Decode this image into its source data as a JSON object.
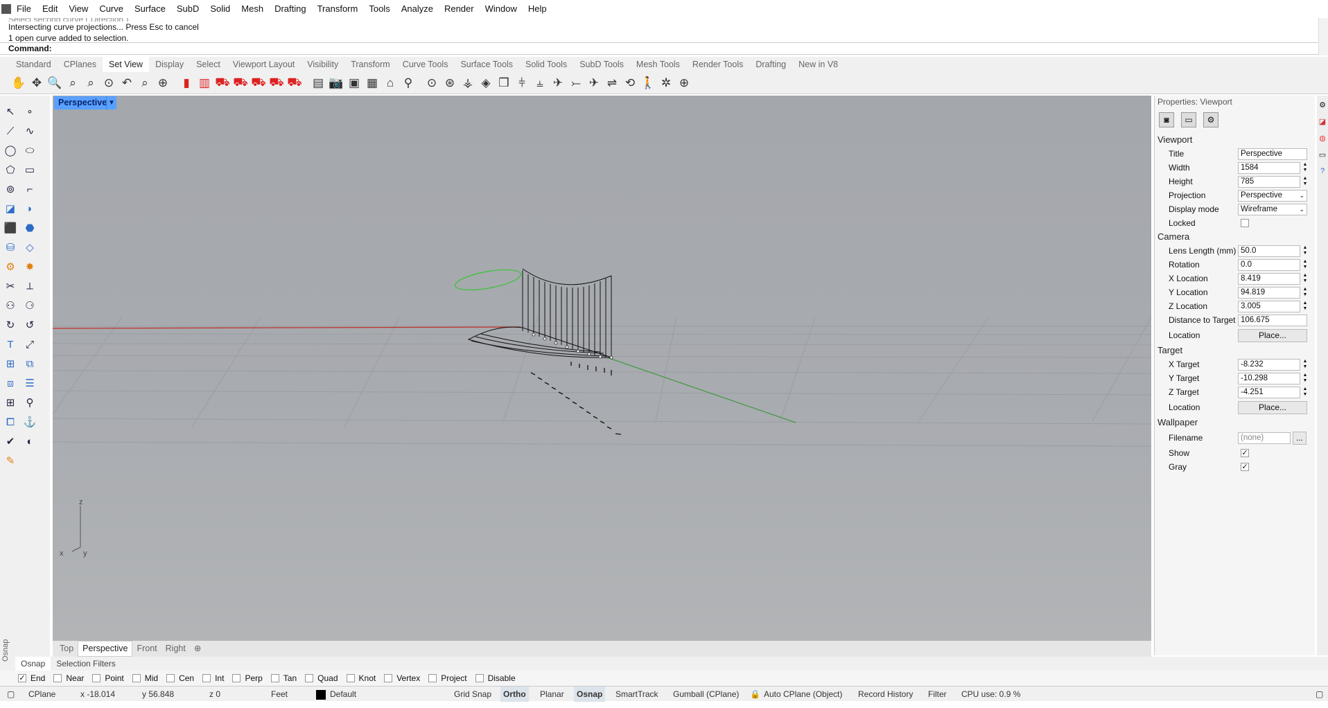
{
  "menu": [
    "File",
    "Edit",
    "View",
    "Curve",
    "Surface",
    "SubD",
    "Solid",
    "Mesh",
    "Drafting",
    "Transform",
    "Tools",
    "Analyze",
    "Render",
    "Window",
    "Help"
  ],
  "history": {
    "line0": "Select second curve ( Direction )",
    "line1": "Intersecting curve projections... Press Esc to cancel",
    "line2": "1 open curve added to selection."
  },
  "command": {
    "label": "Command:"
  },
  "toolbar_tabs": [
    "Standard",
    "CPlanes",
    "Set View",
    "Display",
    "Select",
    "Viewport Layout",
    "Visibility",
    "Transform",
    "Curve Tools",
    "Surface Tools",
    "Solid Tools",
    "SubD Tools",
    "Mesh Tools",
    "Render Tools",
    "Drafting",
    "New in V8"
  ],
  "toolbar_icons": [
    "pan-icon",
    "rotate-view-icon",
    "zoom-dynamic-icon",
    "zoom-window-icon",
    "zoom-extents-icon",
    "zoom-selected-icon",
    "undo-view-icon",
    "zoom-out-icon",
    "zoom-1to1-icon",
    "camera-red-icon",
    "camera-icon",
    "car-front-icon",
    "car-side-icon",
    "car-left-icon",
    "car-right-icon",
    "car-back-icon",
    "car-perspective-icon",
    "plan-icon",
    "named-view-icon",
    "snapshot-icon",
    "layout-icon",
    "set-camera-icon",
    "target-icon",
    "circle-view-icon",
    "zenith-icon",
    "globe-icon",
    "render-icon",
    "cube-icon",
    "align-x-icon",
    "align-y-icon",
    "align-z-icon",
    "flag-icon",
    "plane-icon",
    "plane-flat-icon",
    "orbit-360-icon",
    "walk-icon",
    "turntable-icon",
    "focus-icon"
  ],
  "active_tab": "Set View",
  "viewport": {
    "title": "Perspective",
    "axis_z": "z",
    "axis_x": "x",
    "axis_y": "y"
  },
  "viewport_tabs": [
    "Top",
    "Perspective",
    "Front",
    "Right"
  ],
  "active_viewport_tab": "Perspective",
  "properties": {
    "header": "Properties: Viewport",
    "sections": {
      "viewport": "Viewport",
      "camera": "Camera",
      "target": "Target",
      "wallpaper": "Wallpaper"
    },
    "title": {
      "label": "Title",
      "value": "Perspective"
    },
    "width": {
      "label": "Width",
      "value": "1584"
    },
    "height": {
      "label": "Height",
      "value": "785"
    },
    "projection": {
      "label": "Projection",
      "value": "Perspective"
    },
    "display_mode": {
      "label": "Display mode",
      "value": "Wireframe"
    },
    "locked": {
      "label": "Locked"
    },
    "lens": {
      "label": "Lens Length (mm)",
      "value": "50.0"
    },
    "rotation": {
      "label": "Rotation",
      "value": "0.0"
    },
    "xloc": {
      "label": "X Location",
      "value": "8.419"
    },
    "yloc": {
      "label": "Y Location",
      "value": "94.819"
    },
    "zloc": {
      "label": "Z Location",
      "value": "3.005"
    },
    "dist": {
      "label": "Distance to Target",
      "value": "106.675"
    },
    "cam_location": {
      "label": "Location",
      "button": "Place..."
    },
    "xt": {
      "label": "X Target",
      "value": "-8.232"
    },
    "yt": {
      "label": "Y Target",
      "value": "-10.298"
    },
    "zt": {
      "label": "Z Target",
      "value": "-4.251"
    },
    "tgt_location": {
      "label": "Location",
      "button": "Place..."
    },
    "filename": {
      "label": "Filename",
      "value": "(none)",
      "button": "..."
    },
    "show": {
      "label": "Show"
    },
    "gray": {
      "label": "Gray"
    }
  },
  "osnap_tabs": [
    "Osnap",
    "Selection Filters"
  ],
  "osnap_side_label": "Osnap",
  "snaps": [
    {
      "label": "End",
      "checked": true
    },
    {
      "label": "Near",
      "checked": false
    },
    {
      "label": "Point",
      "checked": false
    },
    {
      "label": "Mid",
      "checked": false
    },
    {
      "label": "Cen",
      "checked": false
    },
    {
      "label": "Int",
      "checked": false
    },
    {
      "label": "Perp",
      "checked": false
    },
    {
      "label": "Tan",
      "checked": false
    },
    {
      "label": "Quad",
      "checked": false
    },
    {
      "label": "Knot",
      "checked": false
    },
    {
      "label": "Vertex",
      "checked": false
    },
    {
      "label": "Project",
      "checked": false
    },
    {
      "label": "Disable",
      "checked": false
    }
  ],
  "status": {
    "cplane": "CPlane",
    "x": "x -18.014",
    "y": "y 56.848",
    "z": "z 0",
    "units": "Feet",
    "layer": "Default",
    "grid_snap": "Grid Snap",
    "ortho": "Ortho",
    "planar": "Planar",
    "osnap": "Osnap",
    "smarttrack": "SmartTrack",
    "gumball": "Gumball (CPlane)",
    "autocplane": "Auto CPlane (Object)",
    "record": "Record History",
    "filter": "Filter",
    "cpu": "CPU use: 0.9 %"
  },
  "colors": {
    "accent": "#5aa0ff",
    "x_axis": "#c0302a",
    "y_axis": "#3c9a3c",
    "viewport_bg": "#a6a9ae"
  }
}
